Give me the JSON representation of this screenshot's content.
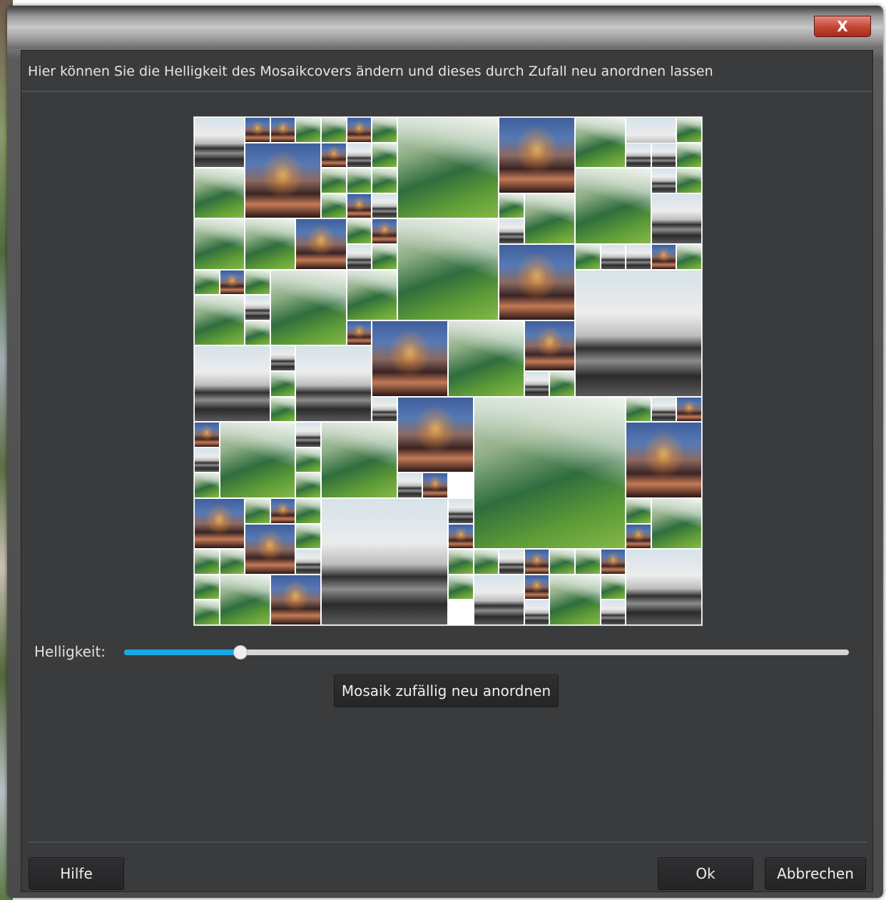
{
  "window": {
    "close_label": "X"
  },
  "dialog": {
    "description": "Hier können Sie die Helligkeit des Mosaikcovers ändern und dieses durch Zufall neu anordnen lassen",
    "brightness_label": "Helligkeit:",
    "brightness_value": 0.16,
    "shuffle_button": "Mosaik zufällig neu anordnen"
  },
  "footer": {
    "help_button": "Hilfe",
    "ok_button": "Ok",
    "cancel_button": "Abbrechen"
  },
  "colors": {
    "accent": "#19a7e2",
    "dialog_background": "#3a3b3d",
    "close_button": "#c64a38"
  },
  "mosaic": {
    "photo_types": [
      "forest",
      "city",
      "snow"
    ]
  }
}
